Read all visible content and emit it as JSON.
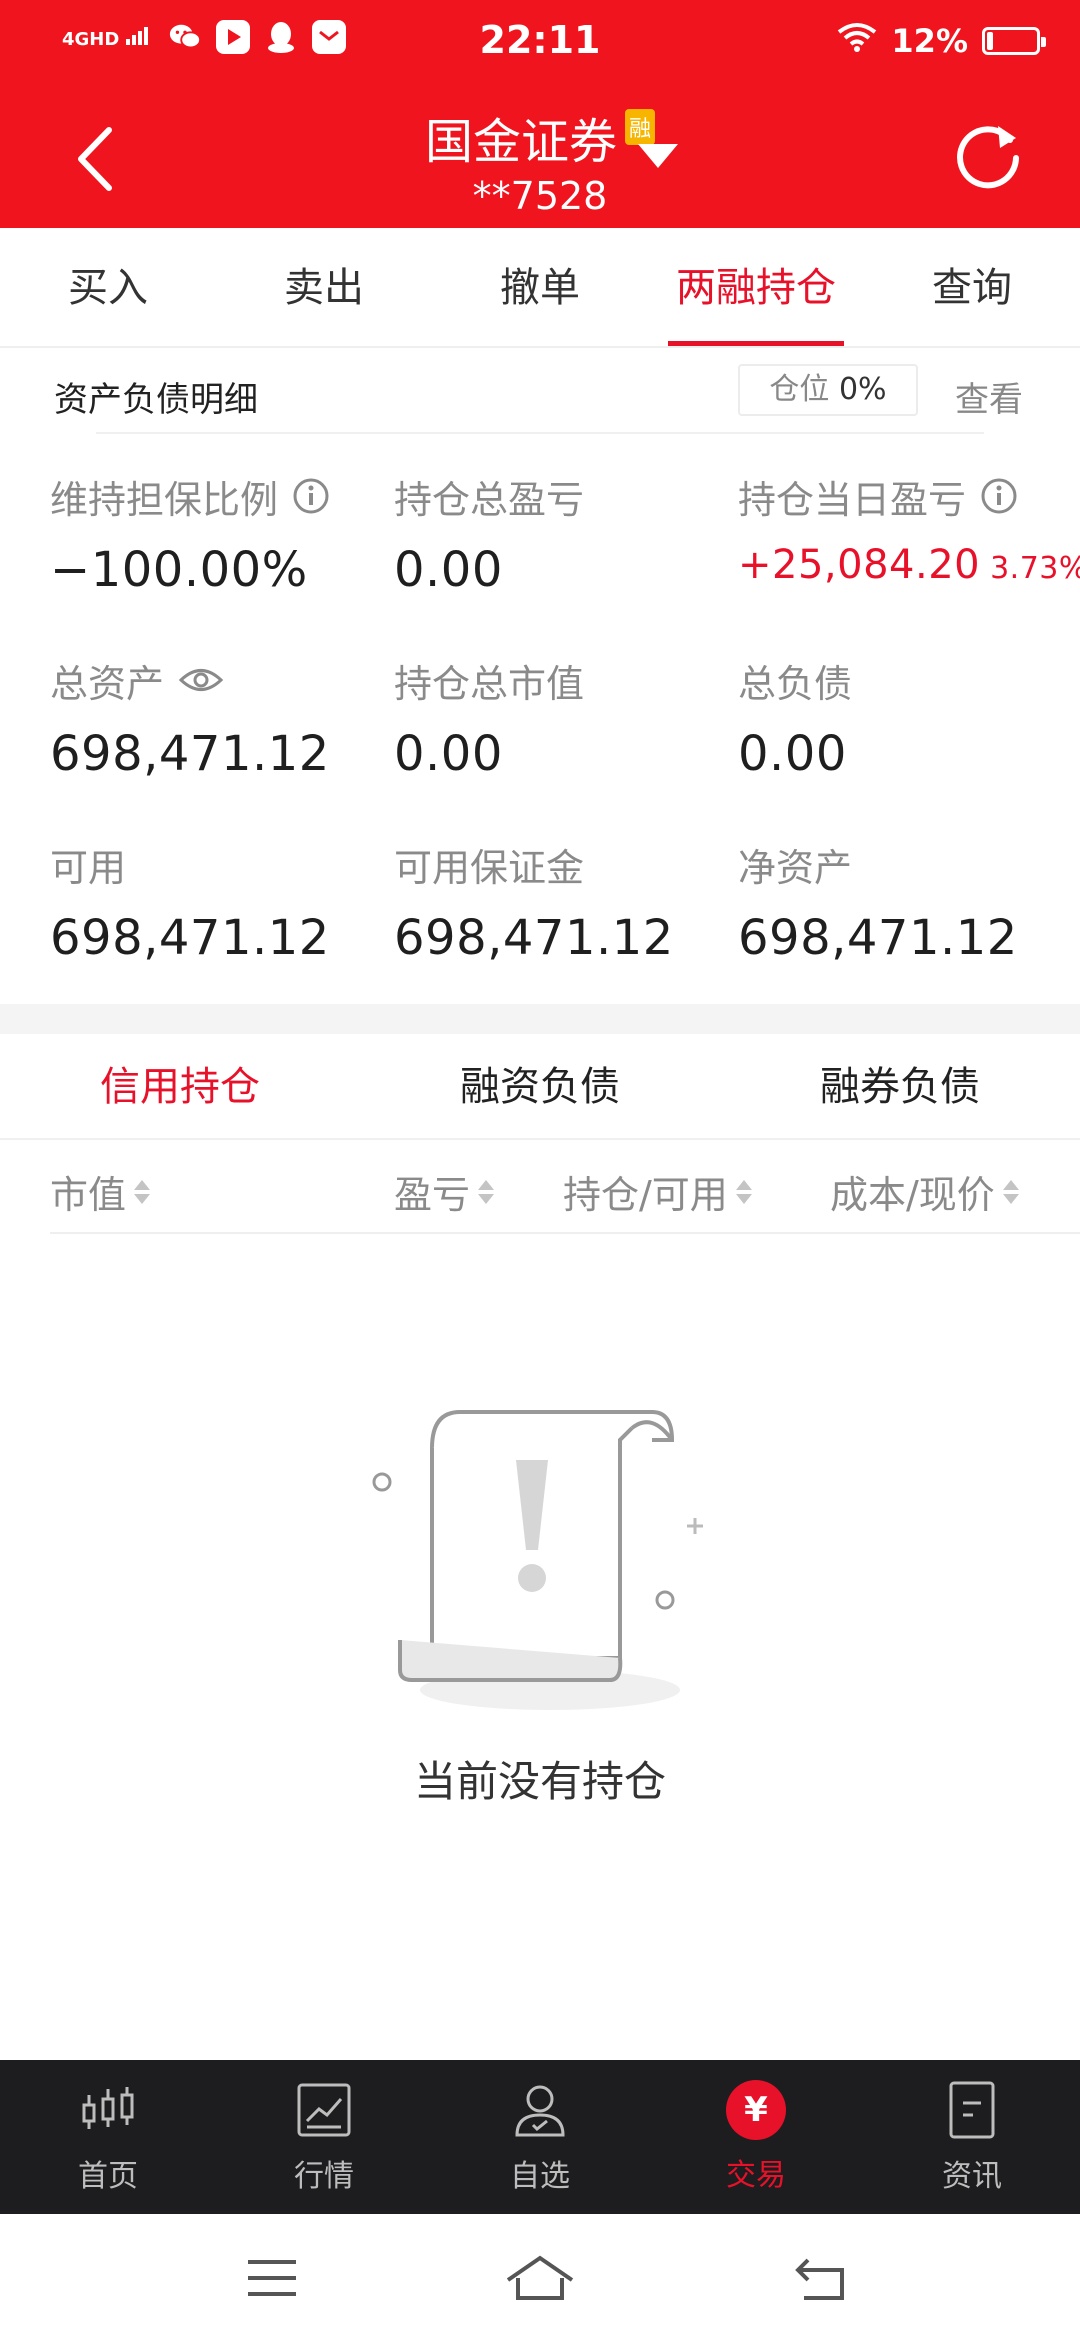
{
  "status_bar": {
    "time": "22:11",
    "network": "4GHD",
    "battery": "12%",
    "icons": [
      "signal-icon",
      "wechat-icon",
      "video-app-icon",
      "qq-icon",
      "mail-app-icon",
      "wifi-icon",
      "battery-icon"
    ]
  },
  "header": {
    "title": "国金证券",
    "badge": "融",
    "account": "**7528",
    "back_icon": "back-icon",
    "refresh_icon": "refresh-icon"
  },
  "tabs": [
    {
      "label": "买入"
    },
    {
      "label": "卖出"
    },
    {
      "label": "撤单"
    },
    {
      "label": "两融持仓",
      "active": true
    },
    {
      "label": "查询"
    }
  ],
  "detail": {
    "title": "资产负债明细",
    "position_label": "仓位",
    "position_value": "0%",
    "view_label": "查看"
  },
  "metrics": {
    "maintenance_ratio": {
      "label": "维持担保比例",
      "value": "−100.00%"
    },
    "total_pnl": {
      "label": "持仓总盈亏",
      "value": "0.00"
    },
    "daily_pnl": {
      "label": "持仓当日盈亏",
      "value": "+25,084.20",
      "pct": "3.73%"
    },
    "total_assets": {
      "label": "总资产",
      "value": "698,471.12"
    },
    "total_market_value": {
      "label": "持仓总市值",
      "value": "0.00"
    },
    "total_liabilities": {
      "label": "总负债",
      "value": "0.00"
    },
    "available": {
      "label": "可用",
      "value": "698,471.12"
    },
    "available_margin": {
      "label": "可用保证金",
      "value": "698,471.12"
    },
    "net_assets": {
      "label": "净资产",
      "value": "698,471.12"
    }
  },
  "subtabs": [
    {
      "label": "信用持仓",
      "active": true
    },
    {
      "label": "融资负债"
    },
    {
      "label": "融券负债"
    }
  ],
  "columns": [
    {
      "label": "市值"
    },
    {
      "label": "盈亏"
    },
    {
      "label": "持仓/可用"
    },
    {
      "label": "成本/现价"
    }
  ],
  "empty_text": "当前没有持仓",
  "bottom_nav": [
    {
      "label": "首页",
      "icon": "candlestick-icon"
    },
    {
      "label": "行情",
      "icon": "trend-chart-icon"
    },
    {
      "label": "自选",
      "icon": "user-star-icon"
    },
    {
      "label": "交易",
      "icon": "yen-icon",
      "active": true,
      "icon_text": "¥"
    },
    {
      "label": "资讯",
      "icon": "news-doc-icon"
    }
  ],
  "colors": {
    "brand_red": "#f0141e",
    "accent_red": "#e8112a",
    "nav_bg": "#1d1d1f"
  }
}
